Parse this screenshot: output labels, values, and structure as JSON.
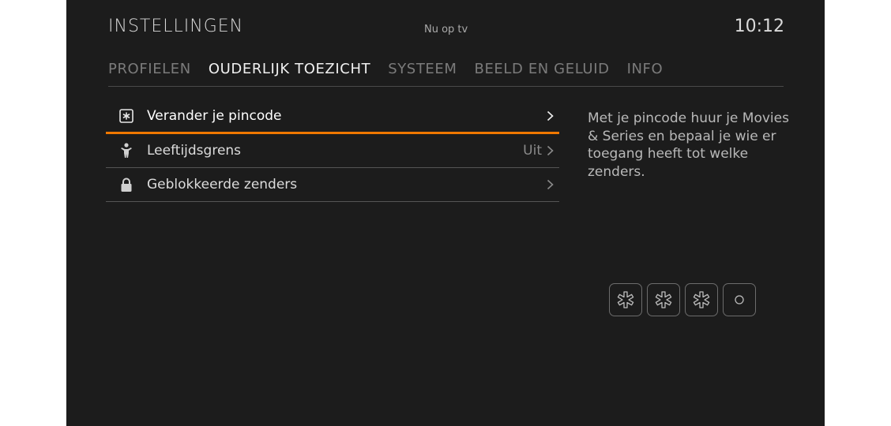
{
  "header": {
    "title": "INSTELLINGEN",
    "center_label": "Nu op tv",
    "clock": "10:12"
  },
  "tabs": [
    {
      "label": "PROFIELEN",
      "active": false
    },
    {
      "label": "OUDERLIJK TOEZICHT",
      "active": true
    },
    {
      "label": "SYSTEEM",
      "active": false
    },
    {
      "label": "BEELD EN GELUID",
      "active": false
    },
    {
      "label": "INFO",
      "active": false
    }
  ],
  "menu": {
    "items": [
      {
        "label": "Verander je pincode",
        "value": "",
        "icon": "asterisk-box-icon",
        "selected": true
      },
      {
        "label": "Leeftijdsgrens",
        "value": "Uit",
        "icon": "child-icon",
        "selected": false
      },
      {
        "label": "Geblokkeerde zenders",
        "value": "",
        "icon": "lock-icon",
        "selected": false
      }
    ]
  },
  "description": "Met je pincode huur je Movies & Series en bepaal je wie er toegang heeft tot welke zenders.",
  "pin": {
    "entered_digits": 3,
    "total_digits": 4
  },
  "colors": {
    "background": "#1c1c1c",
    "accent": "#f07800"
  }
}
